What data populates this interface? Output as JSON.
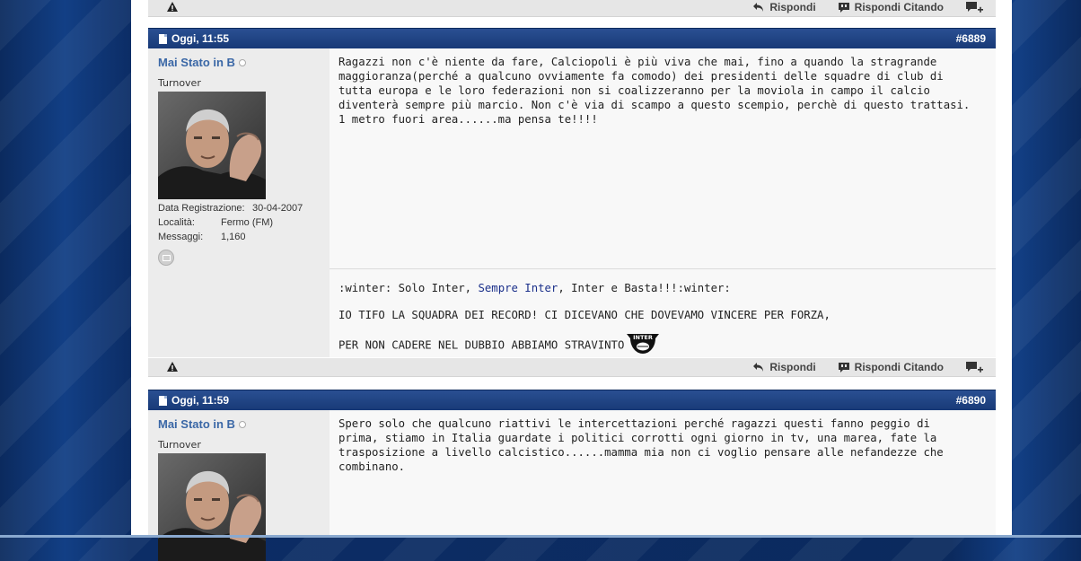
{
  "actions": {
    "reply": "Rispondi",
    "quote": "Rispondi Citando"
  },
  "posts": [
    {
      "date": "Oggi, 11:55",
      "number": "#6889",
      "username": "Mai Stato in B",
      "user_title": "Turnover",
      "registration_label": "Data Registrazione:",
      "registration": "30-04-2007",
      "location_label": "Località:",
      "location": "Fermo (FM)",
      "messages_label": "Messaggi:",
      "messages": "1,160",
      "text": "Ragazzi non c'è niente da fare, Calciopoli è più viva che mai, fino a quando la stragrande maggioranza(perché a qualcuno ovviamente fa comodo) dei presidenti delle squadre di club di tutta europa e le loro federazioni non si coalizzeranno per la moviola in campo il calcio diventerà sempre più marcio. Non c'è via di scampo a questo scempio, perchè di questo trattasi. 1 metro fuori area......ma pensa te!!!!",
      "sig_part1": ":winter: Solo Inter, ",
      "sig_link": "Sempre Inter",
      "sig_part2": ", Inter e Basta!!!:winter:",
      "sig_line2": "IO TIFO LA SQUADRA DEI RECORD! CI DICEVANO CHE DOVEVAMO VINCERE PER FORZA,",
      "sig_line3": "PER NON CADERE NEL DUBBIO ABBIAMO STRAVINTO",
      "badge_text": "INTER"
    },
    {
      "date": "Oggi, 11:59",
      "number": "#6890",
      "username": "Mai Stato in B",
      "user_title": "Turnover",
      "text": "Spero solo che qualcuno riattivi le intercettazioni perché ragazzi questi fanno peggio di prima, stiamo in Italia guardate i politici corrotti ogni giorno in tv, una marea, fate la trasposizione a livello calcistico......mamma mia non ci voglio pensare alle nefandezze che combinano."
    }
  ]
}
